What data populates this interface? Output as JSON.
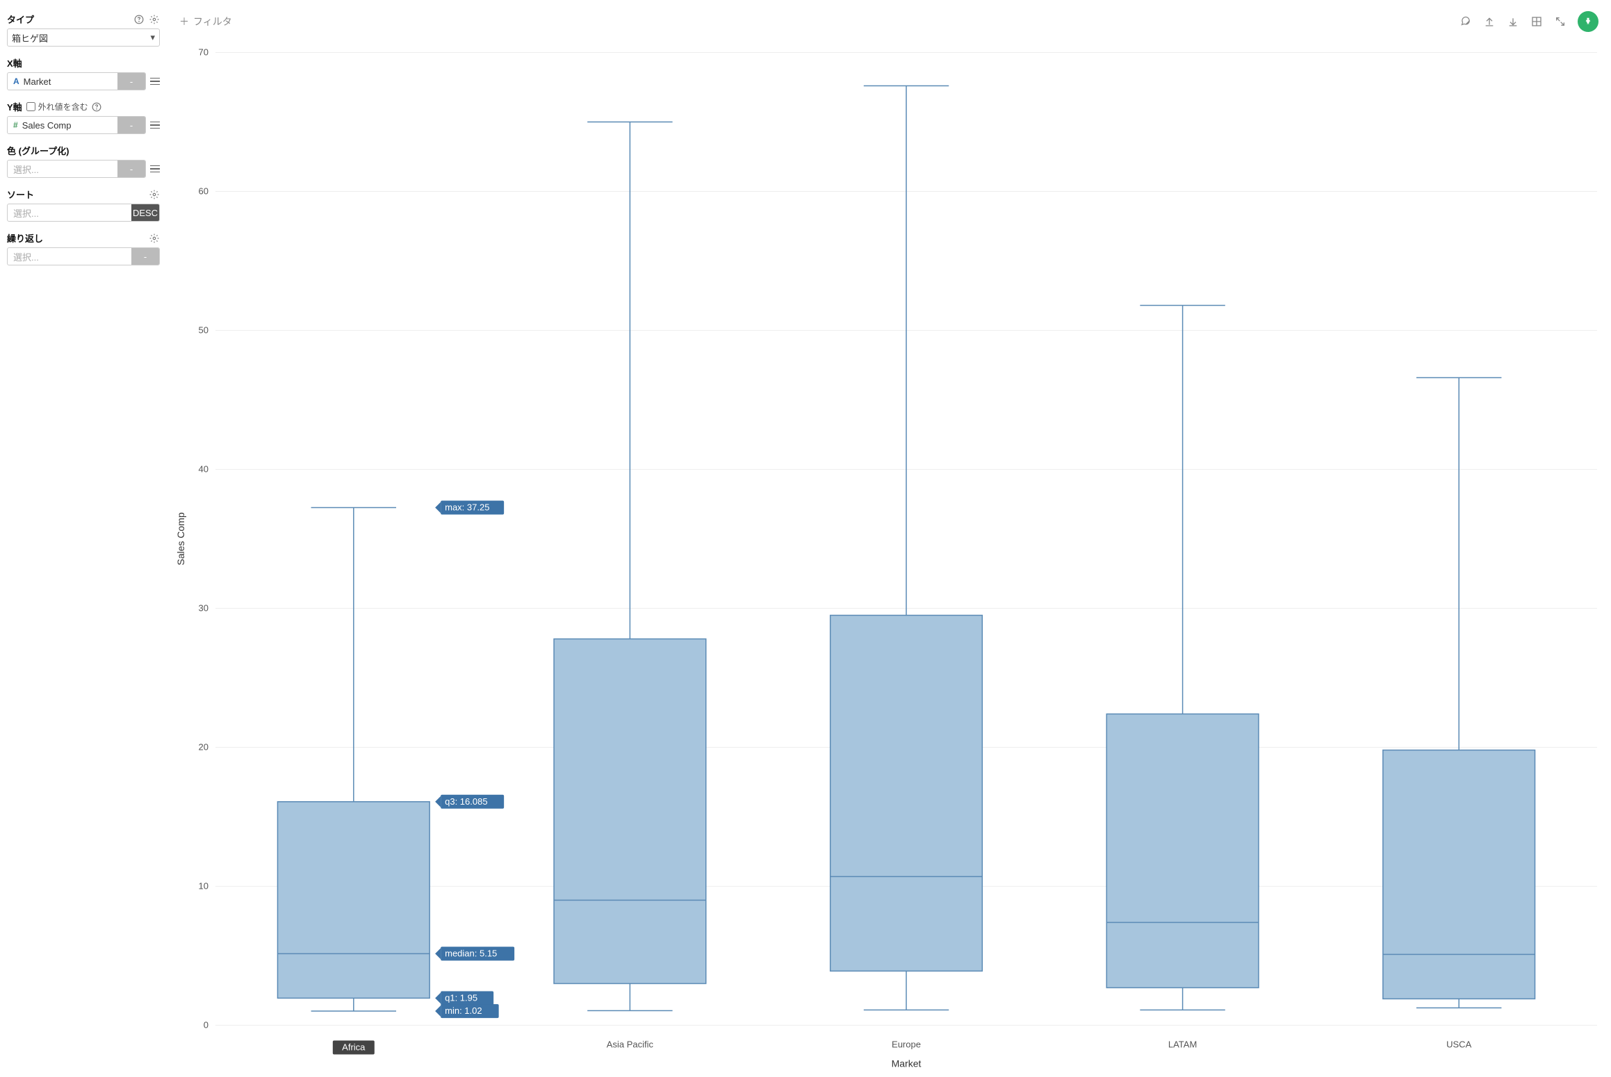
{
  "sidebar": {
    "type_label": "タイプ",
    "type_value": "箱ヒゲ図",
    "x_label": "X軸",
    "x_field": "Market",
    "x_agg": "-",
    "y_label": "Y軸",
    "outlier_label": "外れ値を含む",
    "y_field": "Sales Comp",
    "y_agg": "-",
    "color_label": "色 (グループ化)",
    "color_value": "選択...",
    "color_agg": "-",
    "sort_label": "ソート",
    "sort_value": "選択...",
    "sort_dir": "DESC",
    "repeat_label": "繰り返し",
    "repeat_value": "選択...",
    "repeat_agg": "-"
  },
  "topbar": {
    "filter_label": "フィルタ"
  },
  "chart_data": {
    "type": "boxplot",
    "xlabel": "Market",
    "ylabel": "Sales Comp",
    "ylim": [
      0,
      70
    ],
    "yticks": [
      0,
      10,
      20,
      30,
      40,
      50,
      60,
      70
    ],
    "categories": [
      "Africa",
      "Asia Pacific",
      "Europe",
      "LATAM",
      "USCA"
    ],
    "series": [
      {
        "name": "Africa",
        "min": 1.02,
        "q1": 1.95,
        "median": 5.15,
        "q3": 16.085,
        "max": 37.25
      },
      {
        "name": "Asia Pacific",
        "min": 1.05,
        "q1": 3.0,
        "median": 9.0,
        "q3": 27.8,
        "max": 65.0
      },
      {
        "name": "Europe",
        "min": 1.1,
        "q1": 3.9,
        "median": 10.7,
        "q3": 29.5,
        "max": 67.6
      },
      {
        "name": "LATAM",
        "min": 1.1,
        "q1": 2.7,
        "median": 7.4,
        "q3": 22.4,
        "max": 51.8
      },
      {
        "name": "USCA",
        "min": 1.25,
        "q1": 1.9,
        "median": 5.1,
        "q3": 19.8,
        "max": 46.6
      }
    ],
    "highlighted_category": "Africa",
    "annotations": [
      {
        "label": "max: 37.25",
        "value": 37.25
      },
      {
        "label": "q3: 16.085",
        "value": 16.085
      },
      {
        "label": "median: 5.15",
        "value": 5.15
      },
      {
        "label": "q1: 1.95",
        "value": 1.95
      },
      {
        "label": "min: 1.02",
        "value": 1.02
      }
    ]
  }
}
